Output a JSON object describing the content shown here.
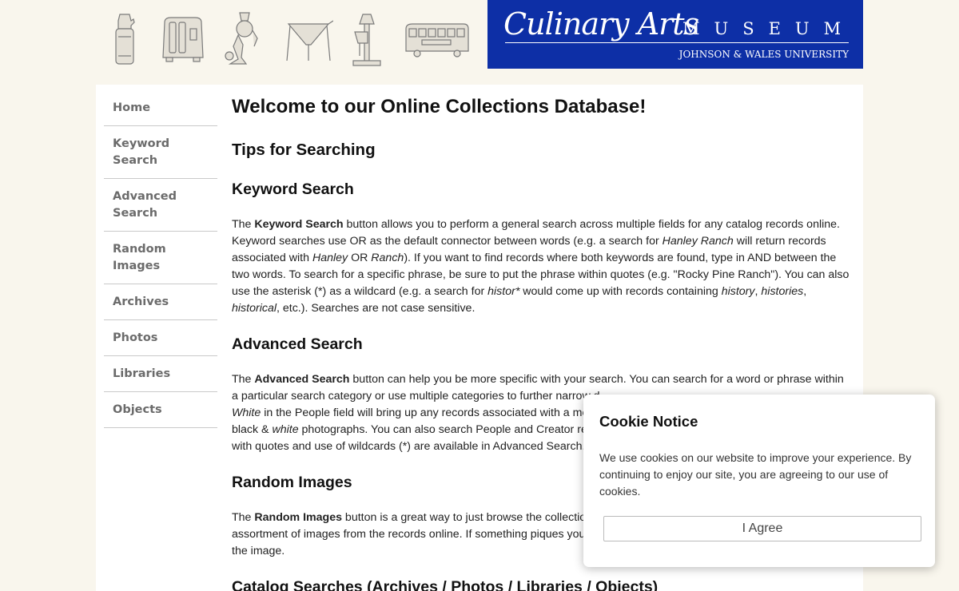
{
  "header": {
    "brand_script": "Culinary Arts",
    "brand_word": "MUSEUM",
    "brand_university": "JOHNSON & WALES UNIVERSITY",
    "brand_color": "#0d2fa6",
    "tool_icons": [
      "seltzer-bottle-icon",
      "toaster-icon",
      "meat-grinder-icon",
      "funnel-stand-icon",
      "mixer-icon",
      "trolley-car-icon"
    ]
  },
  "nav": {
    "items": [
      {
        "label": "Home"
      },
      {
        "label": "Keyword Search"
      },
      {
        "label": "Advanced Search"
      },
      {
        "label": "Random Images"
      },
      {
        "label": "Archives"
      },
      {
        "label": "Photos"
      },
      {
        "label": "Libraries"
      },
      {
        "label": "Objects"
      }
    ]
  },
  "main": {
    "title": "Welcome to our Online Collections Database!",
    "tips_heading": "Tips for Searching",
    "keyword": {
      "heading": "Keyword Search",
      "p1": "The ",
      "b1": "Keyword Search",
      "p2": " button allows you to perform a general search across multiple fields for any catalog records online. Keyword searches use OR as the default connector between words (e.g. a search for ",
      "i1": "Hanley Ranch",
      "p3": " will return records associated with ",
      "i2": "Hanley",
      "p4": " OR ",
      "i3": "Ranch",
      "p5": "). If you want to find records where both keywords are found, type in AND between the two words. To search for a specific phrase, be sure to put the phrase within quotes (e.g. \"Rocky Pine Ranch\"). You can also use the asterisk (*) as a wildcard (e.g. a search for ",
      "i4": "histor*",
      "p6": " would come up with records containing ",
      "i5": "history",
      "p7": ", ",
      "i6": "histories",
      "p8": ", ",
      "i7": "historical",
      "p9": ", etc.). Searches are not case sensitive."
    },
    "advanced": {
      "heading": "Advanced Search",
      "p1": "The ",
      "b1": "Advanced Search",
      "p2": " button can help you be more specific with your search. You can search for a word or phrase within a particular search category or use multiple categories to further narrow d",
      "i1": "White",
      "p3": " in the People field will bring up any records associated with a me",
      "p4": "black & ",
      "i2": "white",
      "p5": " photographs. You can also search People and Creator re",
      "p6": "with quotes and use of wildcards (*) are available in Advanced Search."
    },
    "random": {
      "heading": "Random Images",
      "p1": "The ",
      "b1": "Random Images",
      "p2": " button is a great way to just browse the collection",
      "p3": "assortment of images from the records online. If something piques your",
      "p4": "the image."
    },
    "catalog_heading": "Catalog Searches (Archives / Photos / Libraries / Objects)"
  },
  "cookie": {
    "title": "Cookie Notice",
    "text": "We use cookies on our website to improve your experience. By continuing to enjoy our site, you are agreeing to our use of cookies.",
    "button": "I Agree"
  }
}
